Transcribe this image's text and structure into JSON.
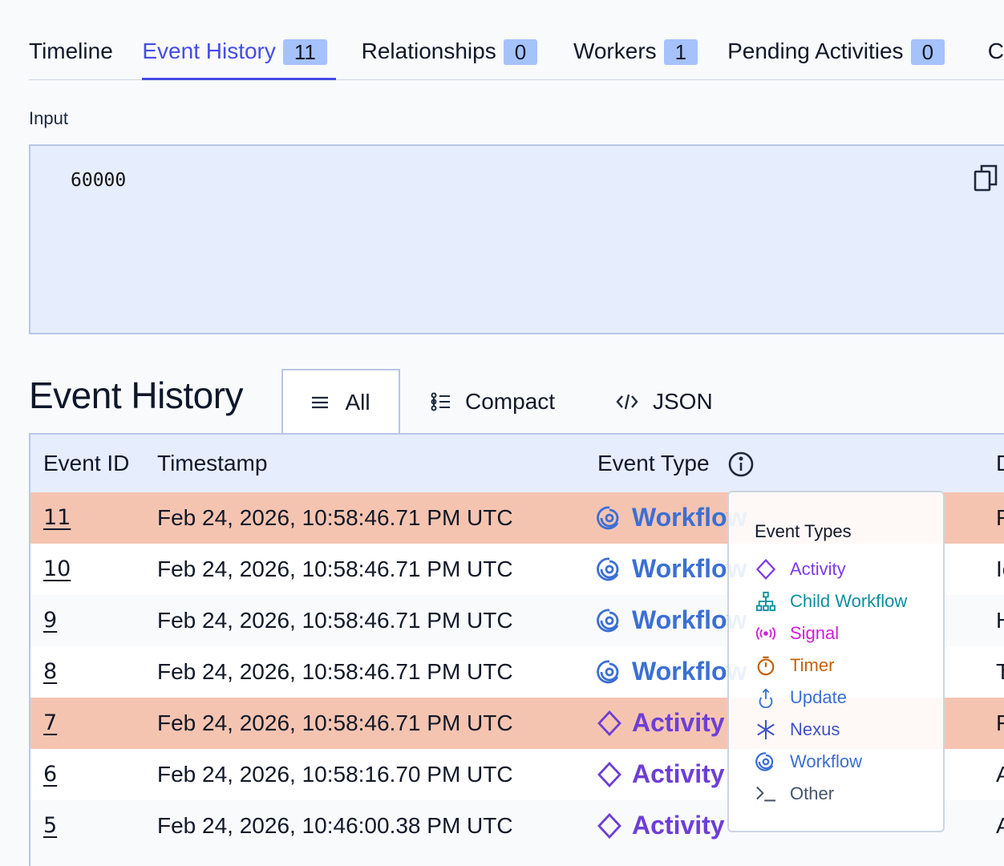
{
  "tabs": [
    {
      "label": "Timeline"
    },
    {
      "label": "Event History",
      "count": "11",
      "active": true
    },
    {
      "label": "Relationships",
      "count": "0"
    },
    {
      "label": "Workers",
      "count": "1"
    },
    {
      "label": "Pending Activities",
      "count": "0"
    },
    {
      "label": "C"
    }
  ],
  "input": {
    "label": "Input",
    "value": "60000"
  },
  "event_history": {
    "title": "Event History",
    "views": {
      "all": "All",
      "compact": "Compact",
      "json": "JSON"
    }
  },
  "table": {
    "headers": {
      "event_id": "Event ID",
      "timestamp": "Timestamp",
      "event_type": "Event Type",
      "details": "D"
    },
    "rows": [
      {
        "id": "11",
        "timestamp": "Feb 24, 2026, 10:58:46.71 PM UTC",
        "type": "Workflow Execution Failed",
        "type_visible": "Workflow",
        "category": "workflow",
        "detail": "F",
        "status": "failed"
      },
      {
        "id": "10",
        "timestamp": "Feb 24, 2026, 10:58:46.71 PM UTC",
        "type": "Workflow Task Completed",
        "type_visible": "Workflow",
        "category": "workflow",
        "detail": "Ic",
        "status": "normal"
      },
      {
        "id": "9",
        "timestamp": "Feb 24, 2026, 10:58:46.71 PM UTC",
        "type": "Workflow Task Started",
        "type_visible": "Workflow",
        "category": "workflow",
        "detail": "H",
        "status": "normal"
      },
      {
        "id": "8",
        "timestamp": "Feb 24, 2026, 10:58:46.71 PM UTC",
        "type": "Workflow Task Scheduled",
        "type_visible": "Workflow",
        "category": "workflow",
        "detail": "T",
        "status": "normal"
      },
      {
        "id": "7",
        "timestamp": "Feb 24, 2026, 10:58:46.71 PM UTC",
        "type": "Activity Task Timed Out",
        "type_visible": "Activity",
        "category": "activity",
        "detail": "F",
        "status": "failed"
      },
      {
        "id": "6",
        "timestamp": "Feb 24, 2026, 10:58:16.70 PM UTC",
        "type": "Activity Task Started",
        "type_visible": "Activity",
        "category": "activity",
        "detail": "A",
        "status": "normal"
      },
      {
        "id": "5",
        "timestamp": "Feb 24, 2026, 10:46:00.38 PM UTC",
        "type": "Activity Task Scheduled",
        "type_visible": "Activity",
        "category": "activity",
        "detail": "A",
        "status": "normal"
      }
    ]
  },
  "event_types_popover": {
    "title": "Event Types",
    "items": [
      {
        "label": "Activity",
        "icon": "diamond-icon",
        "color": "#7c3aed"
      },
      {
        "label": "Child Workflow",
        "icon": "hierarchy-icon",
        "color": "#0e8ea0"
      },
      {
        "label": "Signal",
        "icon": "signal-icon",
        "color": "#d01fd6"
      },
      {
        "label": "Timer",
        "icon": "timer-icon",
        "color": "#c2620a"
      },
      {
        "label": "Update",
        "icon": "upload-icon",
        "color": "#3b6fd4"
      },
      {
        "label": "Nexus",
        "icon": "asterisk-icon",
        "color": "#3f51c8"
      },
      {
        "label": "Workflow",
        "icon": "spiral-icon",
        "color": "#3b6fd4"
      },
      {
        "label": "Other",
        "icon": "terminal-icon",
        "color": "#475569"
      }
    ]
  },
  "colors": {
    "accent": "#444ce7",
    "failed_row": "#f5c4b1",
    "badge": "#a5c2fb",
    "workflow": "#3b6fd4",
    "activity": "#6d3ed6"
  }
}
